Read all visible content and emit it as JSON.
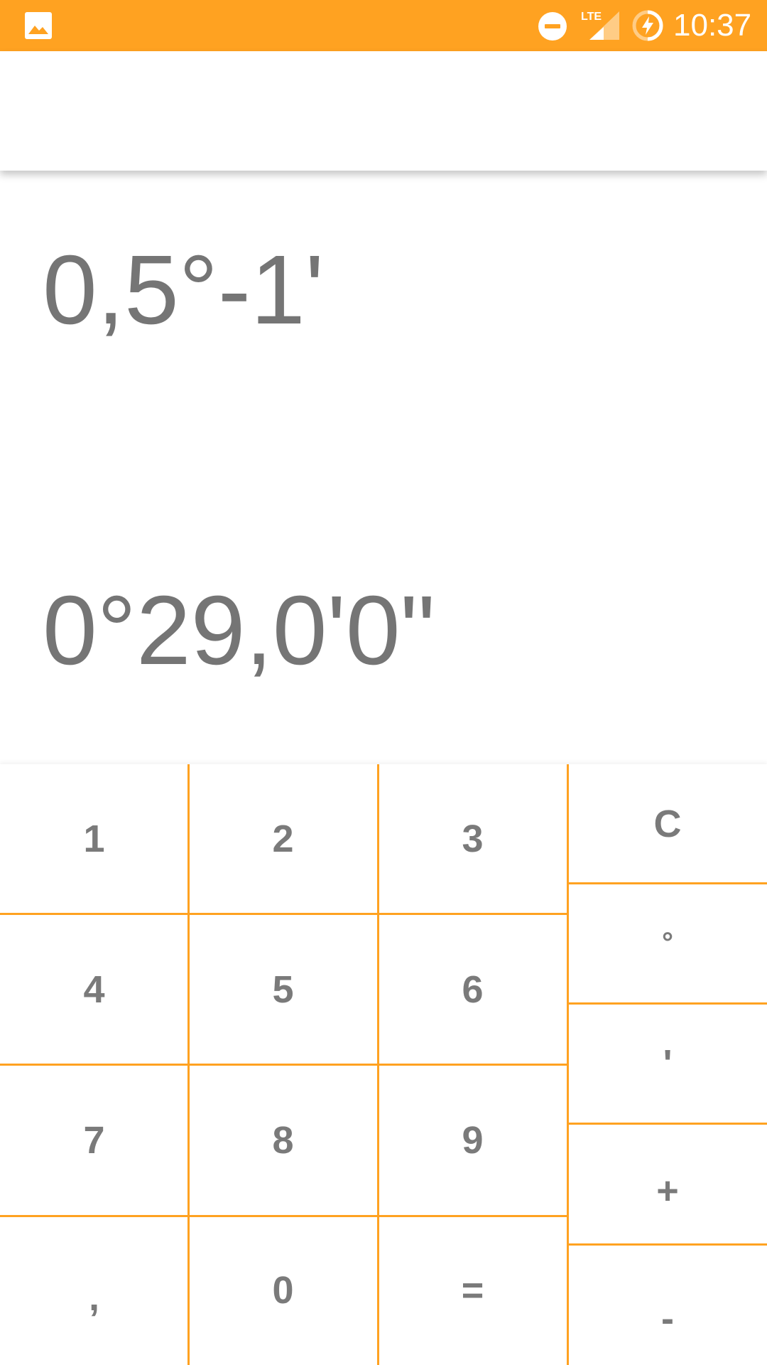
{
  "status_bar": {
    "time": "10:37",
    "network_label": "LTE",
    "background_color": "#FFA221",
    "icons": [
      "gallery-icon",
      "do-not-disturb-icon",
      "lte-signal-icon",
      "battery-charging-icon"
    ]
  },
  "display": {
    "expression": "0,5°-1'",
    "result": "0°29,0'0\""
  },
  "keypad": {
    "accent_color": "#FFA221",
    "digits": {
      "k1": "1",
      "k2": "2",
      "k3": "3",
      "k4": "4",
      "k5": "5",
      "k6": "6",
      "k7": "7",
      "k8": "8",
      "k9": "9",
      "comma": ",",
      "k0": "0",
      "equals": "="
    },
    "operators": {
      "clear": "C",
      "degree": "°",
      "minute": "'",
      "plus": "+",
      "minus": "-"
    }
  }
}
